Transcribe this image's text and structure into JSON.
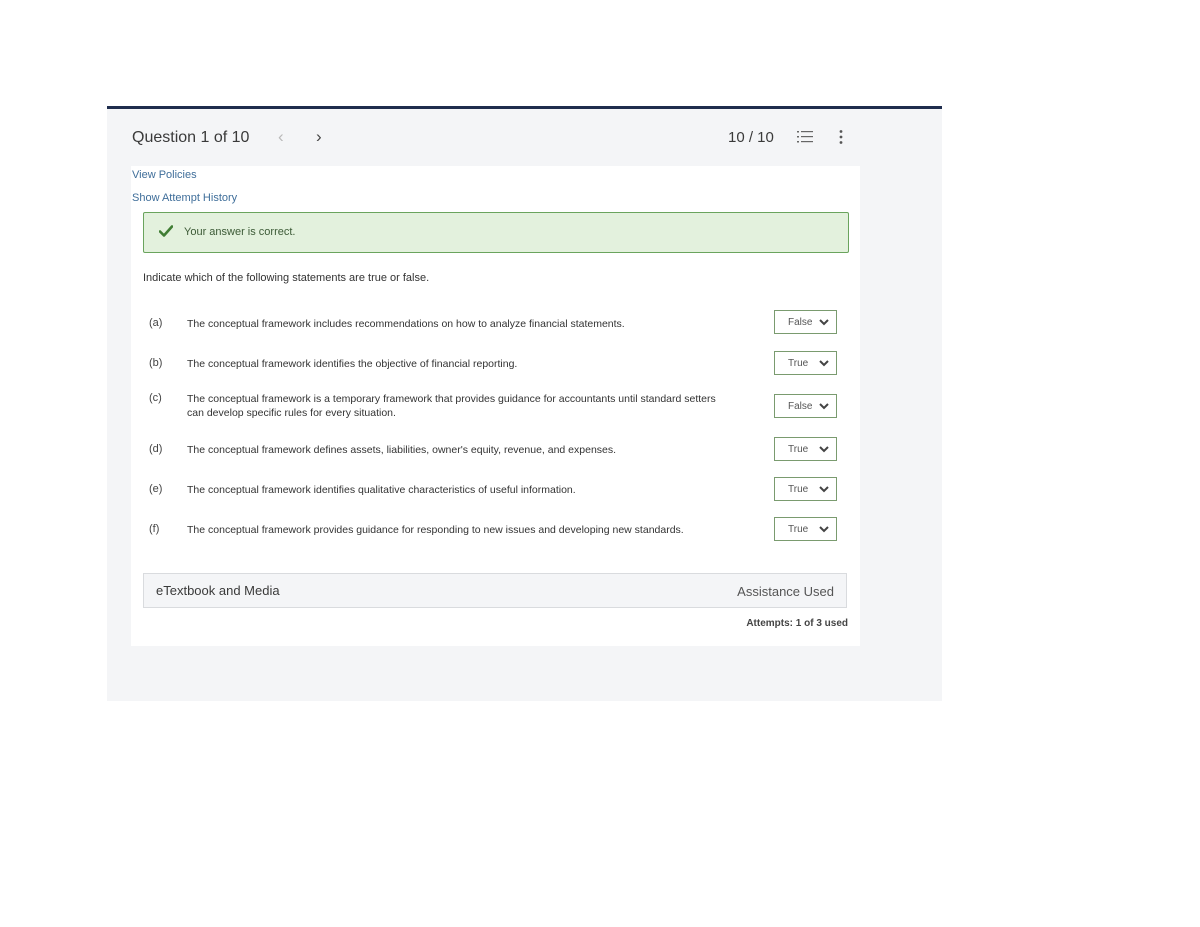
{
  "header": {
    "question_title": "Question 1 of 10",
    "prev_arrow": "‹",
    "next_arrow": "›",
    "score": "10 / 10",
    "list_icon": "list-icon",
    "more_icon": "more-vertical-icon"
  },
  "links": {
    "view_policies": "View Policies",
    "show_attempt_history": "Show Attempt History"
  },
  "feedback": {
    "icon": "checkmark-icon",
    "text": "Your answer is correct."
  },
  "instructions": "Indicate which of the following statements are true or false.",
  "statements": [
    {
      "label": "(a)",
      "text": "The conceptual framework includes recommendations on how to analyze financial statements.",
      "answer": "False"
    },
    {
      "label": "(b)",
      "text": "The conceptual framework identifies the objective of financial reporting.",
      "answer": "True"
    },
    {
      "label": "(c)",
      "text": "The conceptual framework is a temporary framework that provides guidance for accountants until standard setters can develop specific rules for every situation.",
      "answer": "False"
    },
    {
      "label": "(d)",
      "text": "The conceptual framework defines assets, liabilities, owner's equity, revenue, and expenses.",
      "answer": "True"
    },
    {
      "label": "(e)",
      "text": "The conceptual framework identifies qualitative characteristics of useful information.",
      "answer": "True"
    },
    {
      "label": "(f)",
      "text": "The conceptual framework provides guidance for responding to new issues and developing new standards.",
      "answer": "True"
    }
  ],
  "etextbook": {
    "title": "eTextbook and Media",
    "assistance": "Assistance Used"
  },
  "attempts": "Attempts: 1 of 3 used",
  "colors": {
    "header_border": "#1f2d4d",
    "link": "#3f6e9a",
    "feedback_bg": "#e3f1dd",
    "feedback_border": "#6aa45d",
    "check": "#3f7d33"
  }
}
